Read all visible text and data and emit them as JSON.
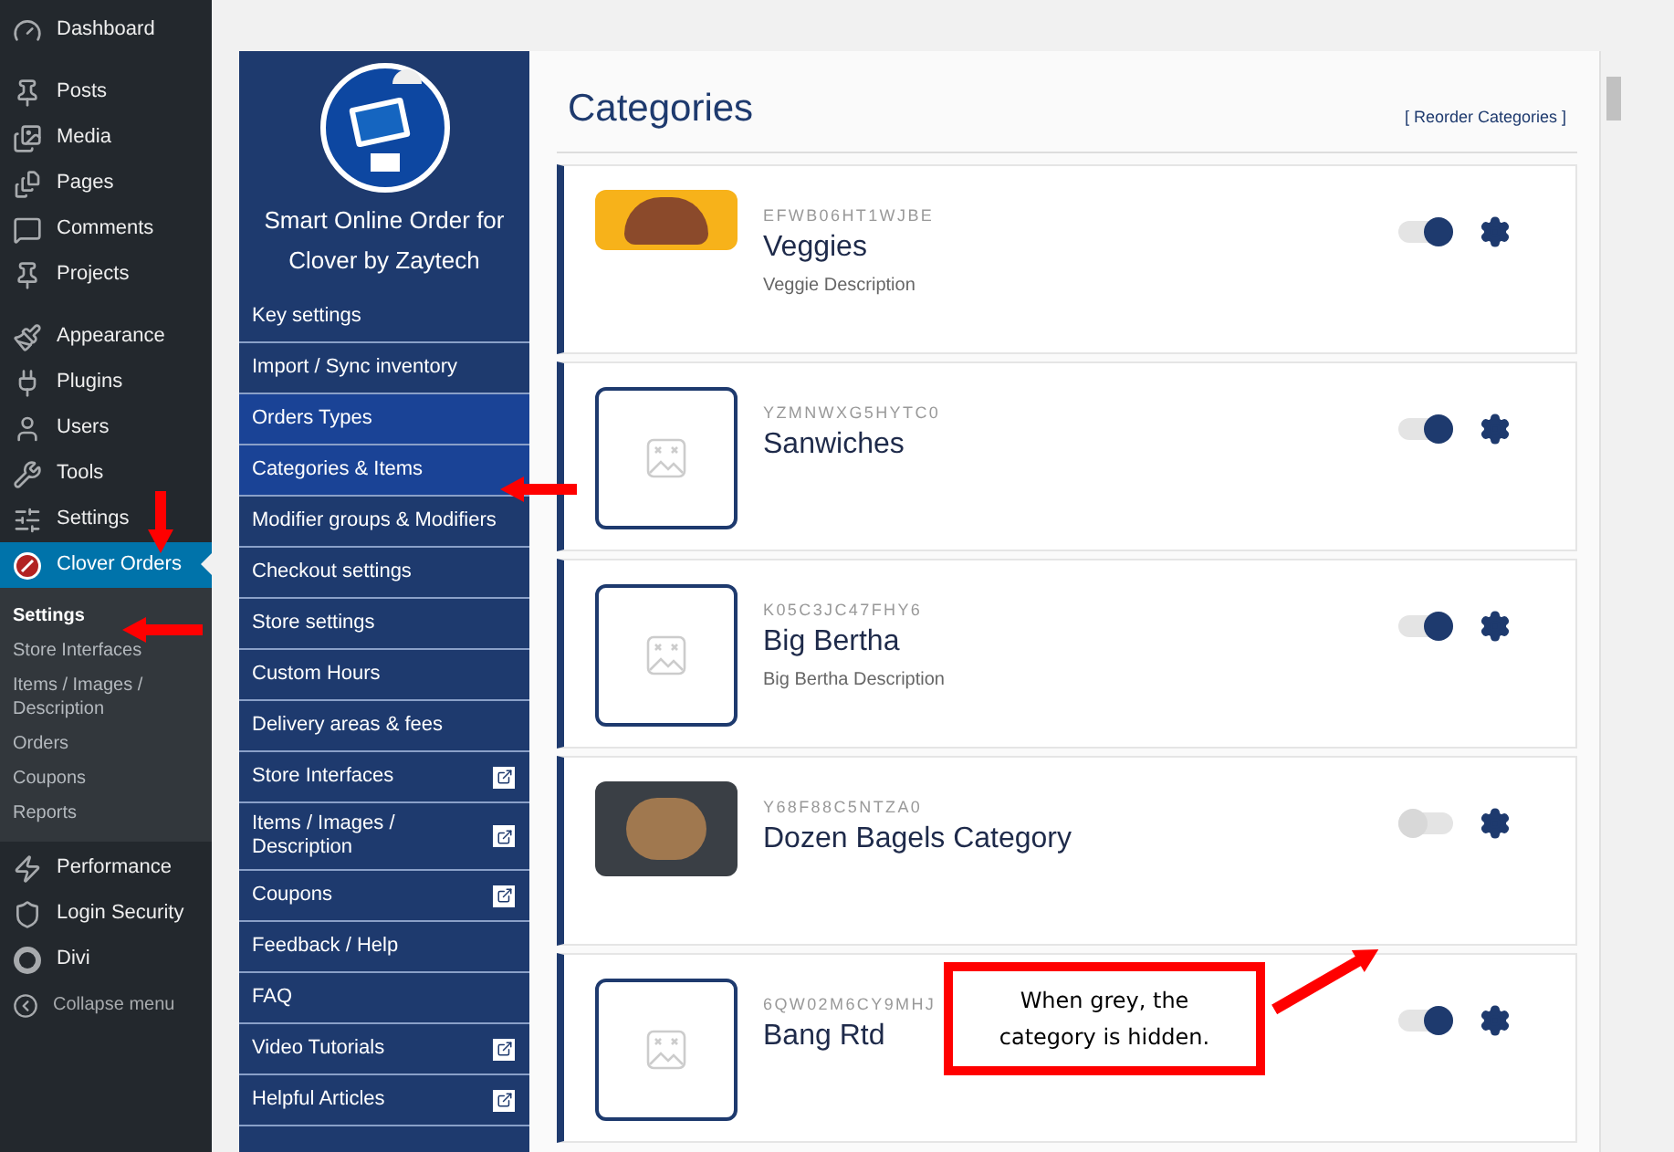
{
  "wp_menu": {
    "sections": [
      [
        {
          "label": "Dashboard",
          "selected": false
        }
      ],
      [
        {
          "label": "Posts",
          "selected": false
        },
        {
          "label": "Media",
          "selected": false
        },
        {
          "label": "Pages",
          "selected": false
        },
        {
          "label": "Comments",
          "selected": false
        },
        {
          "label": "Projects",
          "selected": false
        }
      ],
      [
        {
          "label": "Appearance",
          "selected": false
        },
        {
          "label": "Plugins",
          "selected": false
        },
        {
          "label": "Users",
          "selected": false
        },
        {
          "label": "Tools",
          "selected": false
        },
        {
          "label": "Settings",
          "selected": false
        },
        {
          "label": "Clover Orders",
          "selected": true
        }
      ]
    ],
    "submenu": [
      {
        "label": "Settings",
        "selected": true
      },
      {
        "label": "Store Interfaces",
        "selected": false
      },
      {
        "label": "Items / Images / Description",
        "selected": false
      },
      {
        "label": "Orders",
        "selected": false
      },
      {
        "label": "Coupons",
        "selected": false
      },
      {
        "label": "Reports",
        "selected": false
      }
    ],
    "after": [
      {
        "label": "Performance",
        "selected": false
      },
      {
        "label": "Login Security",
        "selected": false
      },
      {
        "label": "Divi",
        "selected": false
      }
    ],
    "collapse": "Collapse menu"
  },
  "plugin_sidebar": {
    "title": "Smart Online Order for Clover by Zaytech",
    "items": [
      {
        "label": "Key settings",
        "selected": false,
        "external": false
      },
      {
        "label": "Import / Sync inventory",
        "selected": false,
        "external": false
      },
      {
        "label": "Orders Types",
        "selected": true,
        "external": false
      },
      {
        "label": "Categories & Items",
        "selected": true,
        "external": false
      },
      {
        "label": "Modifier groups & Modifiers",
        "selected": false,
        "external": false
      },
      {
        "label": "Checkout settings",
        "selected": false,
        "external": false
      },
      {
        "label": "Store settings",
        "selected": false,
        "external": false
      },
      {
        "label": "Custom Hours",
        "selected": false,
        "external": false
      },
      {
        "label": "Delivery areas & fees",
        "selected": false,
        "external": false
      },
      {
        "label": "Store Interfaces",
        "selected": false,
        "external": true
      },
      {
        "label": "Items / Images / Description",
        "selected": false,
        "external": true
      },
      {
        "label": "Coupons",
        "selected": false,
        "external": true
      },
      {
        "label": "Feedback / Help",
        "selected": false,
        "external": false
      },
      {
        "label": "FAQ",
        "selected": false,
        "external": false
      },
      {
        "label": "Video Tutorials",
        "selected": false,
        "external": true
      },
      {
        "label": "Helpful Articles",
        "selected": false,
        "external": true
      }
    ]
  },
  "content": {
    "title": "Categories",
    "reorder_link": "[ Reorder Categories ]",
    "categories": [
      {
        "code": "EFWB06HT1WJBE",
        "name": "Veggies",
        "description": "Veggie Description",
        "kind": "photo",
        "visible": true
      },
      {
        "code": "YZMNWXG5HYTC0",
        "name": "Sanwiches",
        "kind": "placeholder",
        "visible": true
      },
      {
        "code": "K05C3JC47FHY6",
        "name": "Big Bertha",
        "description": "Big Bertha Description",
        "kind": "placeholder",
        "visible": true
      },
      {
        "code": "Y68F88C5NTZA0",
        "name": "Dozen Bagels Category",
        "kind": "photo",
        "visible": false
      },
      {
        "code": "6QW02M6CY9MHJ",
        "name": "Bang Rtd",
        "kind": "placeholder",
        "visible": true
      }
    ]
  },
  "annotation": {
    "text": "When grey, the category is hidden."
  }
}
